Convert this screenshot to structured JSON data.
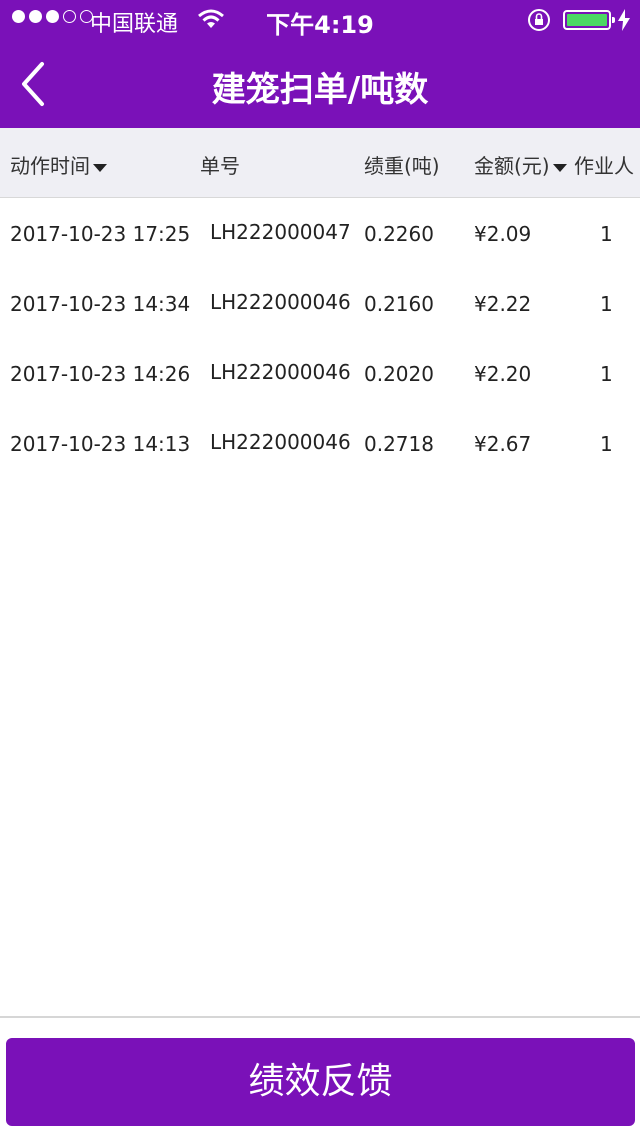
{
  "status_bar": {
    "carrier": "中国联通",
    "time": "下午4:19",
    "signal_icon": "signal-dots",
    "wifi_icon": "wifi-icon",
    "battery_icon": "battery-icon",
    "colors": {
      "battery": "#4cd964"
    }
  },
  "nav": {
    "title": "建笼扫单/吨数",
    "back_icon": "chevron-left-icon",
    "color": "#7a11b8"
  },
  "table": {
    "headers": {
      "time": "动作时间",
      "order_no": "单号",
      "weight": "绩重(吨)",
      "amount": "金额(元)",
      "operator": "作业人"
    },
    "rows": [
      {
        "time": "2017-10-23 17:25",
        "order_no": "LH222000047",
        "weight": "0.2260",
        "amount": "¥2.09",
        "operator": "1"
      },
      {
        "time": "2017-10-23 14:34",
        "order_no": "LH222000046",
        "weight": "0.2160",
        "amount": "¥2.22",
        "operator": "1"
      },
      {
        "time": "2017-10-23 14:26",
        "order_no": "LH222000046",
        "weight": "0.2020",
        "amount": "¥2.20",
        "operator": "1"
      },
      {
        "time": "2017-10-23 14:13",
        "order_no": "LH222000046",
        "weight": "0.2718",
        "amount": "¥2.67",
        "operator": "1"
      }
    ]
  },
  "footer": {
    "button_label": "绩效反馈"
  }
}
